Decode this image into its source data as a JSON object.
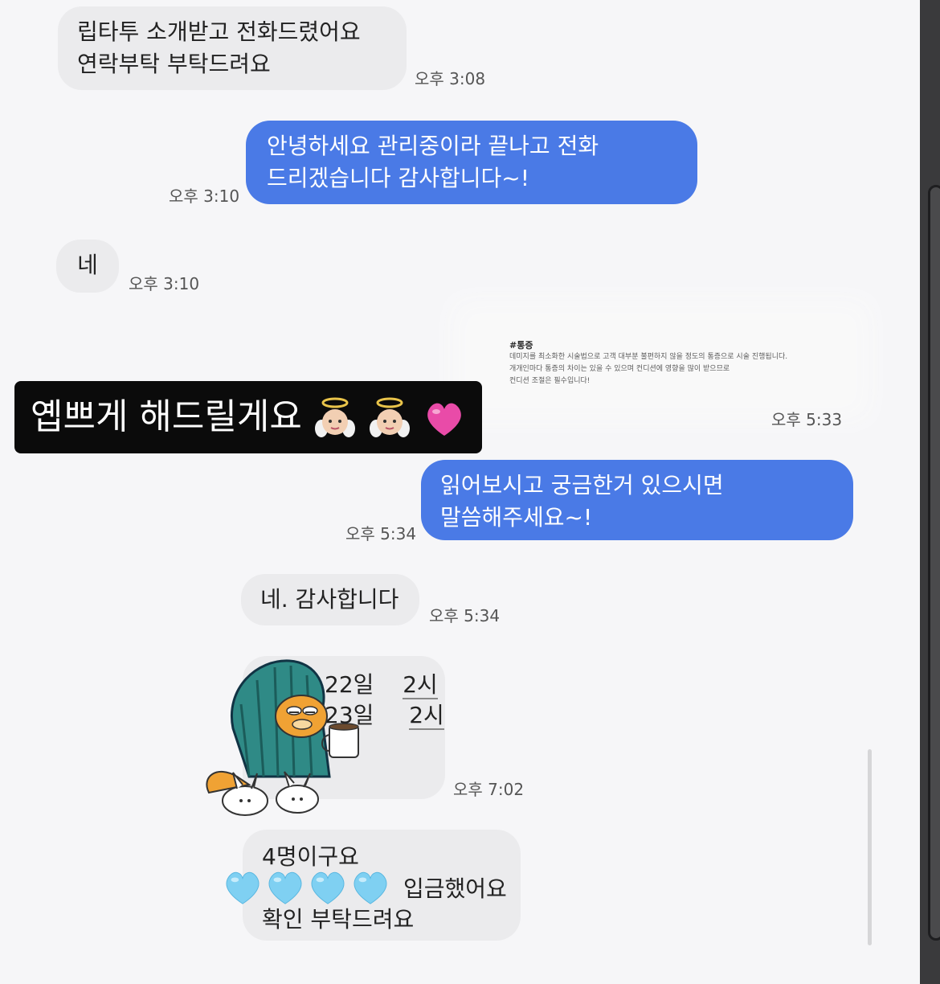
{
  "messages": {
    "m1": {
      "text": "립타투 소개받고 전화드렸어요\n연락부탁 부탁드려요",
      "time": "오후 3:08"
    },
    "m2": {
      "text": "안녕하세요 관리중이라 끝나고 전화\n드리겠습니다 감사합니다~!",
      "time": "오후 3:10"
    },
    "m3": {
      "text": "네",
      "time": "오후 3:10"
    },
    "m4": {
      "time": "오후 5:33"
    },
    "m5": {
      "text": "읽어보시고 궁금한거 있으시면\n말씀해주세요~!",
      "time": "오후 5:34"
    },
    "m6": {
      "text": "네. 감사합니다",
      "time": "오후 5:34"
    },
    "m7": {
      "line1_day": "22일",
      "line1_hour": "2시",
      "line2_day": "23일",
      "line2_hour": "2시",
      "time": "오후 7:02"
    },
    "m8": {
      "line1": "4명이구요",
      "line2": "입금했어요",
      "line3": "확인 부탁드려요"
    }
  },
  "doc_preview": {
    "heading": "#통증",
    "line1": "데미지를 최소화한 시술법으로 고객 대부분 불편하지 않을 정도의 통증으로 시술 진행됩니다.",
    "line2": "개개인마다 통증의 차이는 있을 수 있으며 컨디션에 영향을 많이 받으므로",
    "line3": "컨디션 조절은 필수입니다!"
  },
  "caption": {
    "text": "옙쁘게 해드릴게요"
  },
  "icons": {
    "caption_emojis": [
      "baby-angel-icon",
      "baby-angel-icon",
      "pink-heart-icon"
    ],
    "sticker": "garfield-sticker-icon",
    "hearts": [
      "light-blue-heart-icon",
      "light-blue-heart-icon",
      "light-blue-heart-icon",
      "light-blue-heart-icon"
    ]
  },
  "colors": {
    "outgoing": "#4a7ae6",
    "incoming": "#ebebed",
    "caption_bg": "#0b0b0b"
  }
}
